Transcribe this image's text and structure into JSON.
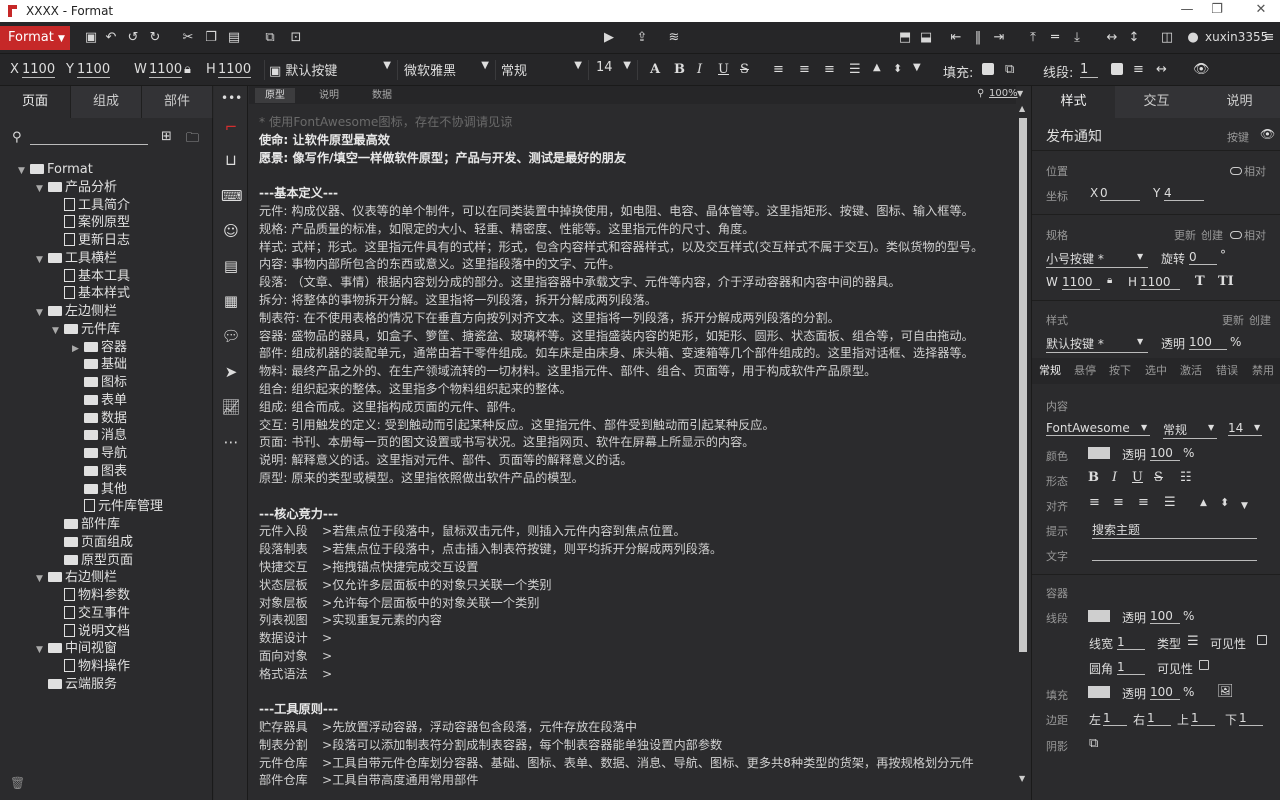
{
  "window": {
    "title": "XXXX - Format",
    "controls": [
      "—",
      "❐",
      "✕"
    ]
  },
  "toolbar1": {
    "format_label": "Format",
    "user": "xuxin3355"
  },
  "toolbar2": {
    "x_label": "X",
    "x_val": "1100",
    "y_label": "Y",
    "y_val": "1100",
    "w_label": "W",
    "w_val": "1100",
    "h_label": "H",
    "h_val": "1100",
    "style_select": "默认按键",
    "font_select": "微软雅黑",
    "weight_select": "常规",
    "size_select": "14",
    "fill_label": "填充:",
    "stroke_label": "线段:",
    "stroke_val": "1"
  },
  "left": {
    "tabs": [
      "页面",
      "组成",
      "部件"
    ],
    "tree": [
      {
        "label": "Format",
        "level": 0,
        "type": "folder",
        "arrow": "▼"
      },
      {
        "label": "产品分析",
        "level": 1,
        "type": "folder",
        "arrow": "▼"
      },
      {
        "label": "工具简介",
        "level": 2,
        "type": "file",
        "arrow": ""
      },
      {
        "label": "案例原型",
        "level": 2,
        "type": "file",
        "arrow": ""
      },
      {
        "label": "更新日志",
        "level": 2,
        "type": "file",
        "arrow": ""
      },
      {
        "label": "工具横栏",
        "level": 1,
        "type": "folder",
        "arrow": "▼"
      },
      {
        "label": "基本工具",
        "level": 2,
        "type": "file",
        "arrow": ""
      },
      {
        "label": "基本样式",
        "level": 2,
        "type": "file",
        "arrow": ""
      },
      {
        "label": "左边侧栏",
        "level": 1,
        "type": "folder",
        "arrow": "▼"
      },
      {
        "label": "元件库",
        "level": 2,
        "type": "folder",
        "arrow": "▼"
      },
      {
        "label": "容器",
        "level": 3,
        "type": "folder",
        "arrow": "▶"
      },
      {
        "label": "基础",
        "level": 3,
        "type": "folder",
        "arrow": ""
      },
      {
        "label": "图标",
        "level": 3,
        "type": "folder",
        "arrow": ""
      },
      {
        "label": "表单",
        "level": 3,
        "type": "folder",
        "arrow": ""
      },
      {
        "label": "数据",
        "level": 3,
        "type": "folder",
        "arrow": ""
      },
      {
        "label": "消息",
        "level": 3,
        "type": "folder",
        "arrow": ""
      },
      {
        "label": "导航",
        "level": 3,
        "type": "folder",
        "arrow": ""
      },
      {
        "label": "图表",
        "level": 3,
        "type": "folder",
        "arrow": ""
      },
      {
        "label": "其他",
        "level": 3,
        "type": "folder",
        "arrow": ""
      },
      {
        "label": "元件库管理",
        "level": 3,
        "type": "file",
        "arrow": ""
      },
      {
        "label": "部件库",
        "level": 2,
        "type": "folder",
        "arrow": ""
      },
      {
        "label": "页面组成",
        "level": 2,
        "type": "folder",
        "arrow": ""
      },
      {
        "label": "原型页面",
        "level": 2,
        "type": "folder",
        "arrow": ""
      },
      {
        "label": "右边侧栏",
        "level": 1,
        "type": "folder",
        "arrow": "▼"
      },
      {
        "label": "物料参数",
        "level": 2,
        "type": "file",
        "arrow": ""
      },
      {
        "label": "交互事件",
        "level": 2,
        "type": "file",
        "arrow": ""
      },
      {
        "label": "说明文档",
        "level": 2,
        "type": "file",
        "arrow": ""
      },
      {
        "label": "中间视窗",
        "level": 1,
        "type": "folder",
        "arrow": "▼"
      },
      {
        "label": "物料操作",
        "level": 2,
        "type": "file",
        "arrow": ""
      },
      {
        "label": "云端服务",
        "level": 1,
        "type": "folder",
        "arrow": ""
      }
    ]
  },
  "canvas": {
    "tabs": [
      "原型",
      "说明",
      "数据"
    ],
    "zoom": "100%",
    "placeholder": "* 使用FontAwesome图标，存在不协调请见谅",
    "lines": [
      {
        "k": "b",
        "t": "使命: 让软件原型最高效"
      },
      {
        "k": "b",
        "t": "愿景: 像写作/填空一样做软件原型；产品与开发、测试是最好的朋友"
      },
      {
        "k": "n",
        "t": ""
      },
      {
        "k": "b",
        "t": "---基本定义---"
      },
      {
        "k": "n",
        "t": "元件: 构成仪器、仪表等的单个制件，可以在同类装置中掉换使用，如电阻、电容、晶体管等。这里指矩形、按键、图标、输入框等。"
      },
      {
        "k": "n",
        "t": "规格: 产品质量的标准，如限定的大小、轻重、精密度、性能等。这里指元件的尺寸、角度。"
      },
      {
        "k": "n",
        "t": "样式: 式样；形式。这里指元件具有的式样；形式，包含内容样式和容器样式，以及交互样式(交互样式不属于交互)。类似货物的型号。"
      },
      {
        "k": "n",
        "t": "内容: 事物内部所包含的东西或意义。这里指段落中的文字、元件。"
      },
      {
        "k": "n",
        "t": "段落: （文章、事情）根据内容划分成的部分。这里指容器中承载文字、元件等内容，介于浮动容器和内容中间的器具。"
      },
      {
        "k": "n",
        "t": "拆分: 将整体的事物拆开分解。这里指将一列段落，拆开分解成两列段落。"
      },
      {
        "k": "n",
        "t": "制表符: 在不使用表格的情况下在垂直方向按列对齐文本。这里指将一列段落，拆开分解成两列段落的分割。"
      },
      {
        "k": "n",
        "t": "容器: 盛物品的器具，如盒子、箩筐、搪瓷盆、玻璃杯等。这里指盛装内容的矩形，如矩形、圆形、状态面板、组合等，可自由拖动。"
      },
      {
        "k": "n",
        "t": "部件: 组成机器的装配单元，通常由若干零件组成。如车床是由床身、床头箱、变速箱等几个部件组成的。这里指对话框、选择器等。"
      },
      {
        "k": "n",
        "t": "物料: 最终产品之外的、在生产领域流转的一切材料。这里指元件、部件、组合、页面等，用于构成软件产品原型。"
      },
      {
        "k": "n",
        "t": "组合: 组织起来的整体。这里指多个物料组织起来的整体。"
      },
      {
        "k": "n",
        "t": "组成: 组合而成。这里指构成页面的元件、部件。"
      },
      {
        "k": "n",
        "t": "交互: 引用触发的定义: 受到触动而引起某种反应。这里指元件、部件受到触动而引起某种反应。"
      },
      {
        "k": "n",
        "t": "页面: 书刊、本册每一页的图文设置或书写状况。这里指网页、软件在屏幕上所显示的内容。"
      },
      {
        "k": "n",
        "t": "说明: 解释意义的话。这里指对元件、部件、页面等的解释意义的话。"
      },
      {
        "k": "n",
        "t": "原型: 原来的类型或模型。这里指依照做出软件产品的模型。"
      },
      {
        "k": "n",
        "t": ""
      },
      {
        "k": "b",
        "t": "---核心竞力---"
      },
      {
        "k": "t",
        "a": "元件入段",
        "t": ">若焦点位于段落中，鼠标双击元件，则插入元件内容到焦点位置。"
      },
      {
        "k": "t",
        "a": "段落制表",
        "t": ">若焦点位于段落中，点击插入制表符按键，则平均拆开分解成两列段落。"
      },
      {
        "k": "t",
        "a": "快捷交互",
        "t": ">拖拽锚点快捷完成交互设置"
      },
      {
        "k": "t",
        "a": "状态层板",
        "t": ">仅允许多层面板中的对象只关联一个类别"
      },
      {
        "k": "t",
        "a": "对象层板",
        "t": ">允许每个层面板中的对象关联一个类别"
      },
      {
        "k": "t",
        "a": "列表视图",
        "t": ">实现重复元素的内容"
      },
      {
        "k": "t",
        "a": "数据设计",
        "t": ">"
      },
      {
        "k": "t",
        "a": "面向对象",
        "t": ">"
      },
      {
        "k": "t",
        "a": "格式语法",
        "t": ">"
      },
      {
        "k": "n",
        "t": ""
      },
      {
        "k": "b",
        "t": "---工具原则---"
      },
      {
        "k": "t",
        "a": "贮存器具",
        "t": ">先放置浮动容器，浮动容器包含段落，元件存放在段落中"
      },
      {
        "k": "t",
        "a": "制表分割",
        "t": ">段落可以添加制表符分割成制表容器，每个制表容器能单独设置内部参数"
      },
      {
        "k": "t",
        "a": "元件仓库",
        "t": ">工具自带元件仓库划分容器、基础、图标、表单、数据、消息、导航、图标、更多共8种类型的货架，再按规格划分元件"
      },
      {
        "k": "t",
        "a": "部件仓库",
        "t": ">工具自带高度通用常用部件"
      }
    ]
  },
  "right": {
    "tabs": [
      "样式",
      "交互",
      "说明"
    ],
    "title": "发布通知",
    "type": "按键",
    "pos_label": "位置",
    "rel_label": "相对",
    "coord_label": "坐标",
    "x": "0",
    "y": "4",
    "spec_label": "规格",
    "update": "更新",
    "create": "创建",
    "spec_select": "小号按键 *",
    "rotate_label": "旋转",
    "rotate": "0",
    "deg": "°",
    "w": "1100",
    "h": "1100",
    "style_label": "样式",
    "style_select": "默认按键 *",
    "opacity_label": "透明",
    "opacity": "100",
    "pct": "%",
    "state_tabs": [
      "常规",
      "悬停",
      "按下",
      "选中",
      "激活",
      "错误",
      "禁用"
    ],
    "content_label": "内容",
    "font": "FontAwesome",
    "weight": "常规",
    "size": "14",
    "color_label": "颜色",
    "shape_label": "形态",
    "align_label": "对齐",
    "hint_label": "提示",
    "hint_val": "搜索主题",
    "text_label": "文字",
    "container_label": "容器",
    "line_label": "线段",
    "linew_label": "线宽",
    "linew": "1",
    "type_label": "类型",
    "visible_label": "可见性",
    "radius_label": "圆角",
    "radius": "1",
    "fill_label": "填充",
    "margin_label": "边距",
    "left_label": "左",
    "right_label": "右",
    "top_label": "上",
    "bottom_label": "下",
    "m": "1",
    "shadow_label": "阴影"
  }
}
